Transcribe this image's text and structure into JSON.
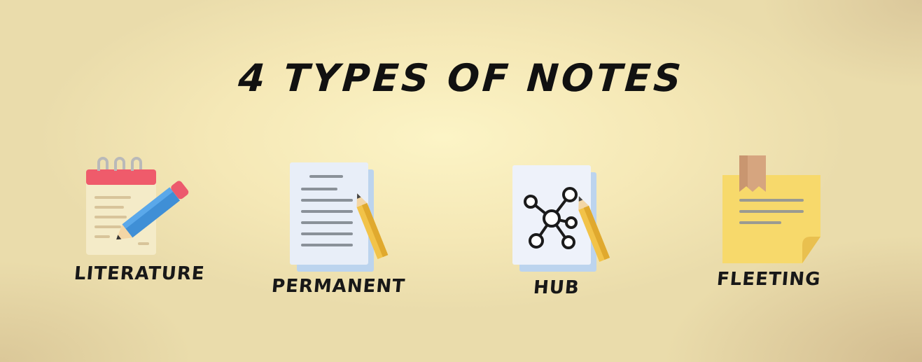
{
  "title": "4 Types of notes",
  "note_types": [
    {
      "label": "Literature",
      "icon": "notepad-pencil-icon"
    },
    {
      "label": "Permanent",
      "icon": "document-pencil-icon"
    },
    {
      "label": "Hub",
      "icon": "network-document-icon"
    },
    {
      "label": "Fleeting",
      "icon": "sticky-note-icon"
    }
  ]
}
